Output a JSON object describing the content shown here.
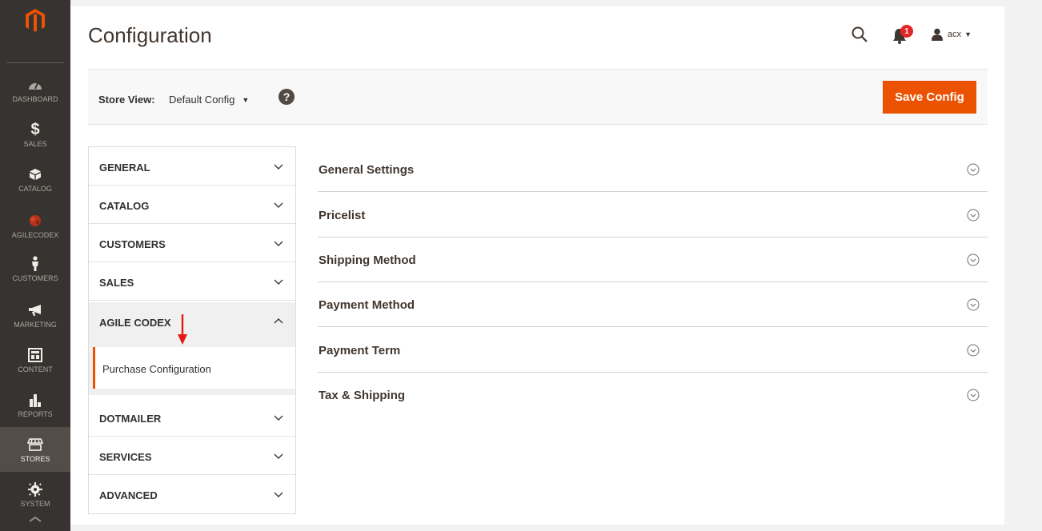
{
  "nav": {
    "items": [
      {
        "label": "DASHBOARD",
        "icon": "dashboard-icon"
      },
      {
        "label": "SALES",
        "icon": "dollar-icon"
      },
      {
        "label": "CATALOG",
        "icon": "catalog-box-icon"
      },
      {
        "label": "AGILECODEX",
        "icon": "agilecodex-icon"
      },
      {
        "label": "CUSTOMERS",
        "icon": "customers-icon"
      },
      {
        "label": "MARKETING",
        "icon": "megaphone-icon"
      },
      {
        "label": "CONTENT",
        "icon": "content-icon"
      },
      {
        "label": "REPORTS",
        "icon": "bar-chart-icon"
      },
      {
        "label": "STORES",
        "icon": "stores-icon"
      },
      {
        "label": "SYSTEM",
        "icon": "gear-icon"
      }
    ],
    "active": "STORES",
    "accent_color": "#eb5202",
    "bg_color": "#373330"
  },
  "header": {
    "title": "Configuration",
    "notification_count": "1",
    "username": "acx"
  },
  "store_view": {
    "label": "Store View:",
    "value": "Default Config",
    "save_label": "Save Config"
  },
  "tabs": [
    {
      "label": "GENERAL",
      "expanded": false
    },
    {
      "label": "CATALOG",
      "expanded": false
    },
    {
      "label": "CUSTOMERS",
      "expanded": false
    },
    {
      "label": "SALES",
      "expanded": false
    },
    {
      "label": "AGILE CODEX",
      "expanded": true,
      "items": [
        "Purchase Configuration"
      ]
    },
    {
      "label": "DOTMAILER",
      "expanded": false
    },
    {
      "label": "SERVICES",
      "expanded": false
    },
    {
      "label": "ADVANCED",
      "expanded": false
    }
  ],
  "sections": [
    {
      "title": "General Settings"
    },
    {
      "title": "Pricelist"
    },
    {
      "title": "Shipping Method"
    },
    {
      "title": "Payment Method"
    },
    {
      "title": "Payment Term"
    },
    {
      "title": "Tax & Shipping"
    }
  ]
}
